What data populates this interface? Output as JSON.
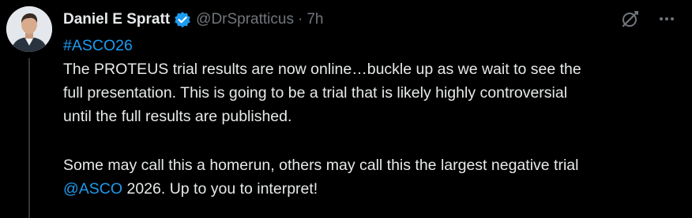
{
  "author": {
    "display_name": "Daniel E Spratt",
    "handle": "@DrSpratticus",
    "separator": "·",
    "time": "7h",
    "verified": true
  },
  "icons": {
    "verified": "verified-badge-icon",
    "grok": "grok-icon",
    "more": "more-options-icon"
  },
  "colors": {
    "background": "#000000",
    "text": "#e7e9ea",
    "secondary": "#71767b",
    "link": "#1d9bf0",
    "thread_line": "#333639"
  },
  "tweet": {
    "hashtag": "#ASCO26",
    "line1": "The PROTEUS trial results are now online…buckle up as we wait to see the",
    "line2": "full presentation. This is going to be a trial that is likely highly controversial",
    "line3": "until the full results are published.",
    "line4": "Some may call this a homerun, others may call this the largest negative trial",
    "mention": "@ASCO",
    "line5_rest": " 2026. Up to you to interpret!"
  }
}
